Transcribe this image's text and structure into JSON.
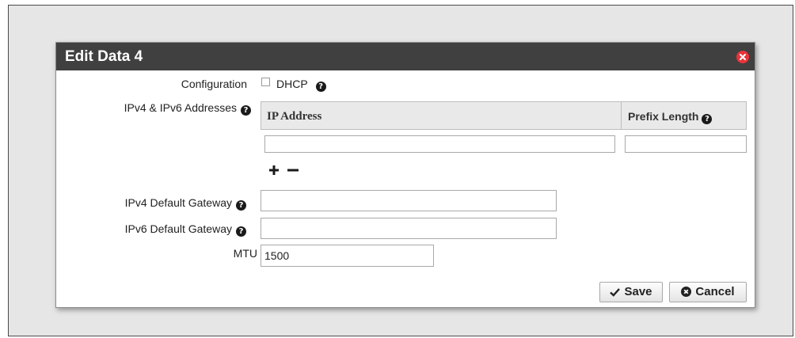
{
  "dialog": {
    "title": "Edit Data 4",
    "close_icon": "close-circle-icon"
  },
  "configuration": {
    "label": "Configuration",
    "dhcp_label": "DHCP",
    "dhcp_checked": false
  },
  "addresses": {
    "label": "IPv4 & IPv6 Addresses",
    "columns": [
      "IP Address",
      "Prefix Length"
    ],
    "rows": [
      {
        "ip_address": "",
        "prefix_length": ""
      }
    ],
    "add_icon": "plus-icon",
    "remove_icon": "minus-icon"
  },
  "gateway4": {
    "label": "IPv4 Default Gateway",
    "value": ""
  },
  "gateway6": {
    "label": "IPv6 Default Gateway",
    "value": ""
  },
  "mtu": {
    "label": "MTU",
    "value": "1500"
  },
  "buttons": {
    "save_label": "Save",
    "cancel_label": "Cancel"
  },
  "colors": {
    "titlebar": "#404040",
    "close": "#e8343a",
    "backdrop": "#e6e6e6"
  }
}
